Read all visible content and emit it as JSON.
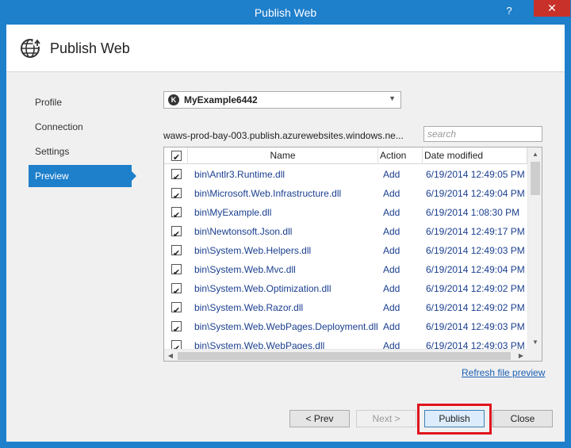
{
  "window": {
    "title": "Publish Web",
    "help_label": "?",
    "close_label": "✕",
    "accent_color": "#1e7fcb"
  },
  "header": {
    "title": "Publish Web",
    "icon": "globe-publish-icon"
  },
  "nav": {
    "items": [
      {
        "label": "Profile",
        "active": false
      },
      {
        "label": "Connection",
        "active": false
      },
      {
        "label": "Settings",
        "active": false
      },
      {
        "label": "Preview",
        "active": true
      }
    ]
  },
  "profile": {
    "selected": "MyExample6442",
    "icon": "profile-icon"
  },
  "site_url": "waws-prod-bay-003.publish.azurewebsites.windows.ne...",
  "search": {
    "placeholder": "search"
  },
  "grid": {
    "columns": {
      "name": "Name",
      "action": "Action",
      "date": "Date modified"
    },
    "rows": [
      {
        "name": "bin\\Antlr3.Runtime.dll",
        "action": "Add",
        "date": "6/19/2014 12:49:05 PM",
        "checked": true
      },
      {
        "name": "bin\\Microsoft.Web.Infrastructure.dll",
        "action": "Add",
        "date": "6/19/2014 12:49:04 PM",
        "checked": true
      },
      {
        "name": "bin\\MyExample.dll",
        "action": "Add",
        "date": "6/19/2014 1:08:30 PM",
        "checked": true
      },
      {
        "name": "bin\\Newtonsoft.Json.dll",
        "action": "Add",
        "date": "6/19/2014 12:49:17 PM",
        "checked": true
      },
      {
        "name": "bin\\System.Web.Helpers.dll",
        "action": "Add",
        "date": "6/19/2014 12:49:03 PM",
        "checked": true
      },
      {
        "name": "bin\\System.Web.Mvc.dll",
        "action": "Add",
        "date": "6/19/2014 12:49:04 PM",
        "checked": true
      },
      {
        "name": "bin\\System.Web.Optimization.dll",
        "action": "Add",
        "date": "6/19/2014 12:49:02 PM",
        "checked": true
      },
      {
        "name": "bin\\System.Web.Razor.dll",
        "action": "Add",
        "date": "6/19/2014 12:49:02 PM",
        "checked": true
      },
      {
        "name": "bin\\System.Web.WebPages.Deployment.dll",
        "action": "Add",
        "date": "6/19/2014 12:49:03 PM",
        "checked": true
      },
      {
        "name": "bin\\System.Web.WebPages.dll",
        "action": "Add",
        "date": "6/19/2014 12:49:03 PM",
        "checked": true
      }
    ]
  },
  "refresh_link": "Refresh file preview",
  "buttons": {
    "prev": "< Prev",
    "next": "Next >",
    "publish": "Publish",
    "close": "Close"
  },
  "highlight_color": "#e0141e"
}
